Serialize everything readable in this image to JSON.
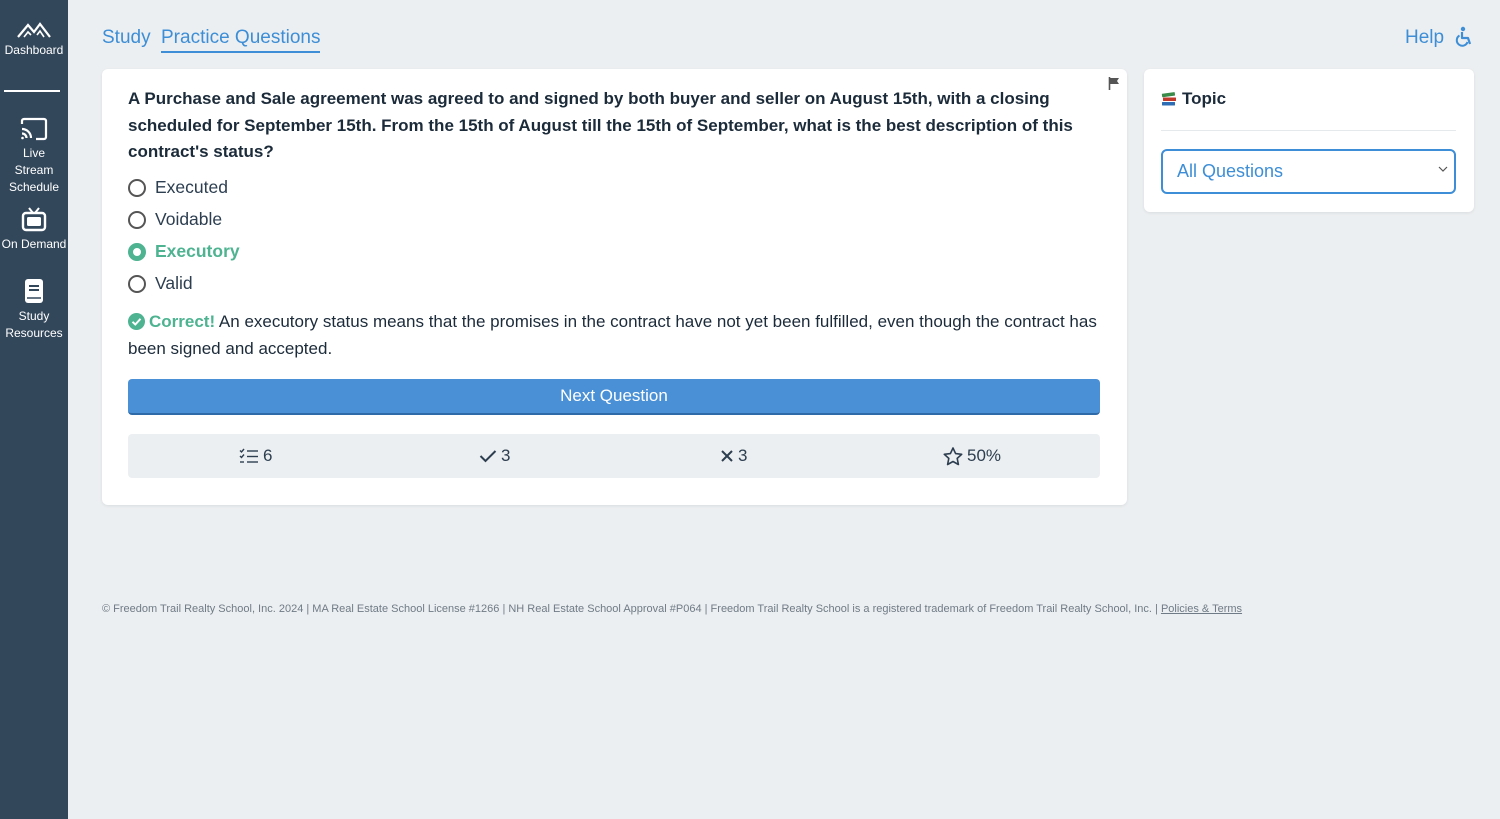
{
  "sidebar": {
    "items": [
      {
        "label": "Dashboard",
        "icon": "mountain-logo-icon"
      },
      {
        "label": "Live Stream Schedule",
        "icon": "cast-icon"
      },
      {
        "label": "On Demand",
        "icon": "tv-icon"
      },
      {
        "label": "Study Resources",
        "icon": "book-icon"
      }
    ]
  },
  "header": {
    "tabs": [
      {
        "label": "Study",
        "active": false
      },
      {
        "label": "Practice Questions",
        "active": true
      }
    ],
    "help_label": "Help",
    "accessibility_icon": "accessibility-icon"
  },
  "question": {
    "text": "A Purchase and Sale agreement was agreed to and signed by both buyer and seller on August 15th, with a closing scheduled for September 15th. From the 15th of August till the 15th of September, what is the best description of this contract's status?",
    "options": [
      {
        "label": "Executed",
        "selected": false
      },
      {
        "label": "Voidable",
        "selected": false
      },
      {
        "label": "Executory",
        "selected": true
      },
      {
        "label": "Valid",
        "selected": false
      }
    ],
    "feedback_label": "Correct!",
    "feedback_text": "An executory status means that the promises in the contract have not yet been fulfilled, even though the contract has been signed and accepted.",
    "next_label": "Next Question",
    "flag_icon": "flag-icon"
  },
  "stats": {
    "total": "6",
    "correct": "3",
    "incorrect": "3",
    "score": "50%"
  },
  "topic": {
    "title": "Topic",
    "icon": "books-icon",
    "selected": "All Questions"
  },
  "footer": {
    "text": "© Freedom Trail Realty School, Inc. 2024 | MA Real Estate School License #1266 | NH Real Estate School Approval #P064 | Freedom Trail Realty School is a registered trademark of Freedom Trail Realty School, Inc. | ",
    "link": "Policies & Terms"
  },
  "colors": {
    "sidebar": "#33475b",
    "accent": "#3d8ed6",
    "success": "#4db390",
    "button": "#4a90d6",
    "background": "#eceff1"
  }
}
